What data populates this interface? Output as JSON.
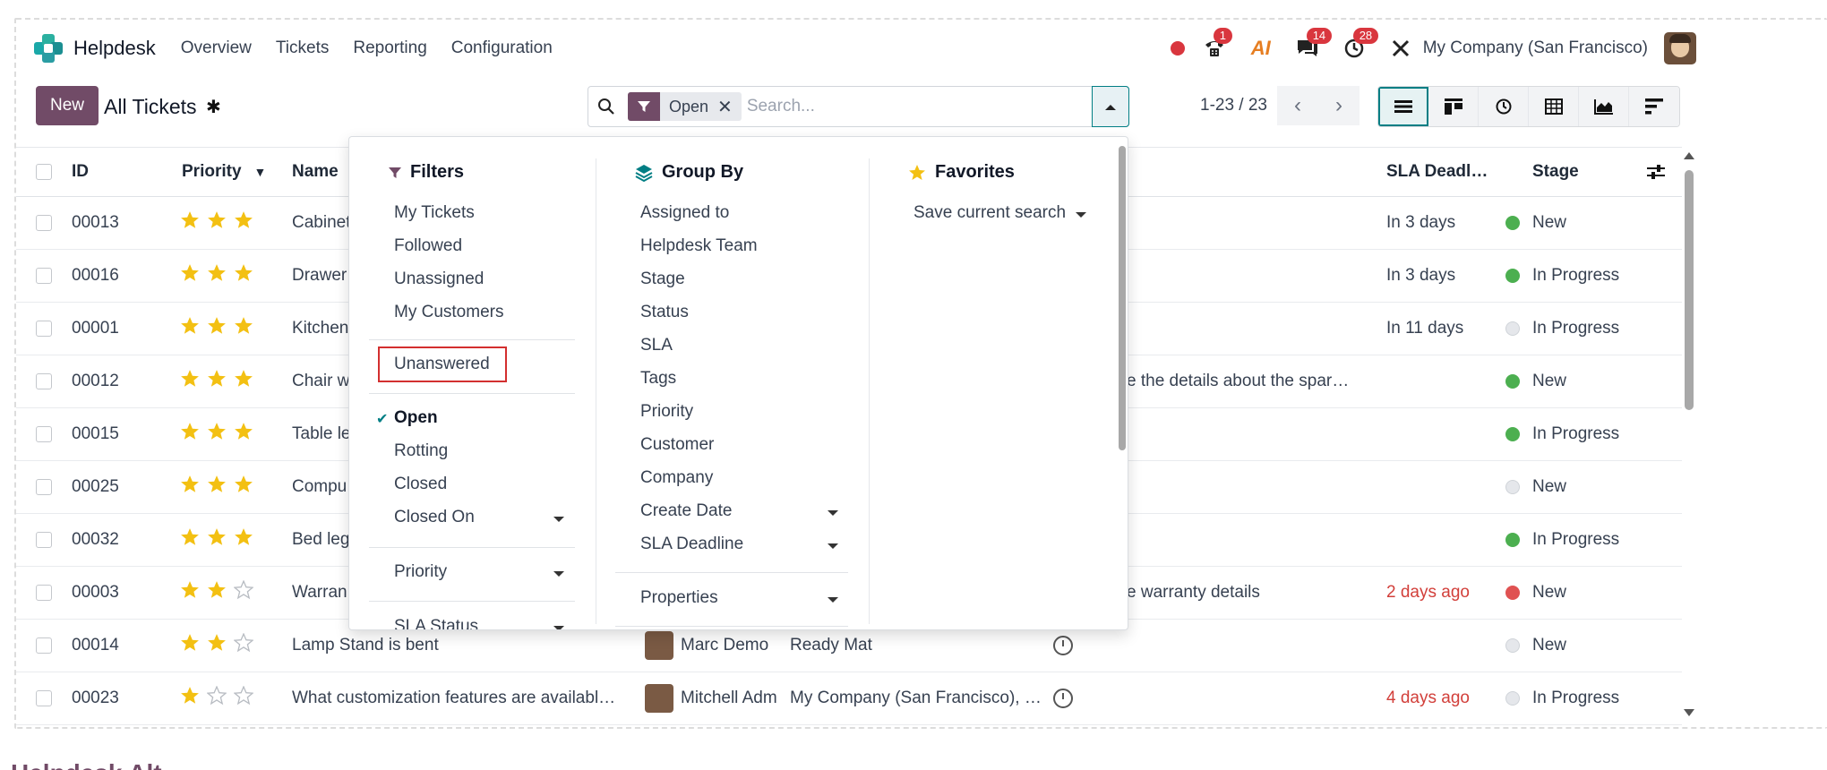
{
  "navbar": {
    "app_name": "Helpdesk",
    "menu": [
      "Overview",
      "Tickets",
      "Reporting",
      "Configuration"
    ],
    "badges": {
      "activity": "1",
      "messages": "14",
      "clock": "28"
    },
    "ai_label": "AI",
    "company": "My Company (San Francisco)"
  },
  "control": {
    "new_label": "New",
    "title": "All Tickets",
    "facet_value": "Open",
    "search_placeholder": "Search...",
    "pager": "1-23 / 23"
  },
  "table": {
    "headers": {
      "id": "ID",
      "priority": "Priority",
      "name": "Name",
      "sla": "SLA Deadl…",
      "stage": "Stage"
    },
    "rows": [
      {
        "id": "00013",
        "stars": 3,
        "name": "Cabinet",
        "desc": "",
        "sla": "In 3 days",
        "sla_red": false,
        "stage": "New",
        "dot": "#4caf50",
        "assignee": "",
        "team": ""
      },
      {
        "id": "00016",
        "stars": 3,
        "name": "Drawer",
        "desc": "",
        "sla": "In 3 days",
        "sla_red": false,
        "stage": "In Progress",
        "dot": "#4caf50",
        "assignee": "",
        "team": ""
      },
      {
        "id": "00001",
        "stars": 3,
        "name": "Kitchen",
        "desc": "",
        "sla": "In 11 days",
        "sla_red": false,
        "stage": "In Progress",
        "dot": "#e5e7eb",
        "assignee": "",
        "team": ""
      },
      {
        "id": "00012",
        "stars": 3,
        "name": "Chair w",
        "desc": "e the details about the spar…",
        "sla": "",
        "sla_red": false,
        "stage": "New",
        "dot": "#4caf50",
        "assignee": "",
        "team": ""
      },
      {
        "id": "00015",
        "stars": 3,
        "name": "Table le",
        "desc": "",
        "sla": "",
        "sla_red": false,
        "stage": "In Progress",
        "dot": "#4caf50",
        "assignee": "",
        "team": ""
      },
      {
        "id": "00025",
        "stars": 3,
        "name": "Compu",
        "desc": "",
        "sla": "",
        "sla_red": false,
        "stage": "New",
        "dot": "#e5e7eb",
        "assignee": "",
        "team": ""
      },
      {
        "id": "00032",
        "stars": 3,
        "name": "Bed leg",
        "desc": "",
        "sla": "",
        "sla_red": false,
        "stage": "In Progress",
        "dot": "#4caf50",
        "assignee": "",
        "team": ""
      },
      {
        "id": "00003",
        "stars": 2,
        "name": "Warran",
        "desc": "e warranty details",
        "sla": "2 days ago",
        "sla_red": true,
        "stage": "New",
        "dot": "#e05252",
        "assignee": "",
        "team": ""
      },
      {
        "id": "00014",
        "stars": 2,
        "name": "Lamp Stand is bent",
        "desc": "",
        "sla": "",
        "sla_red": false,
        "stage": "New",
        "dot": "#e5e7eb",
        "assignee": "Marc Demo",
        "team": "Ready Mat"
      },
      {
        "id": "00023",
        "stars": 1,
        "name": "What customization features are availabl…",
        "desc": "",
        "sla": "4 days ago",
        "sla_red": true,
        "stage": "In Progress",
        "dot": "#e5e7eb",
        "assignee": "Mitchell Adm",
        "team": "My Company (San Francisco), …"
      }
    ]
  },
  "dropdown": {
    "filters": {
      "title": "Filters",
      "group1": [
        "My Tickets",
        "Followed",
        "Unassigned",
        "My Customers"
      ],
      "highlighted": "Unanswered",
      "open": "Open",
      "group3": [
        "Rotting",
        "Closed",
        "Closed On"
      ],
      "priority": "Priority",
      "sla_status": "SLA Status"
    },
    "group_by": {
      "title": "Group By",
      "items": [
        "Assigned to",
        "Helpdesk Team",
        "Stage",
        "Status",
        "SLA",
        "Tags",
        "Priority",
        "Customer",
        "Company",
        "Create Date",
        "SLA Deadline"
      ],
      "properties": "Properties"
    },
    "favorites": {
      "title": "Favorites",
      "save": "Save current search"
    }
  },
  "footer_title": "Helpdesk Alt..."
}
